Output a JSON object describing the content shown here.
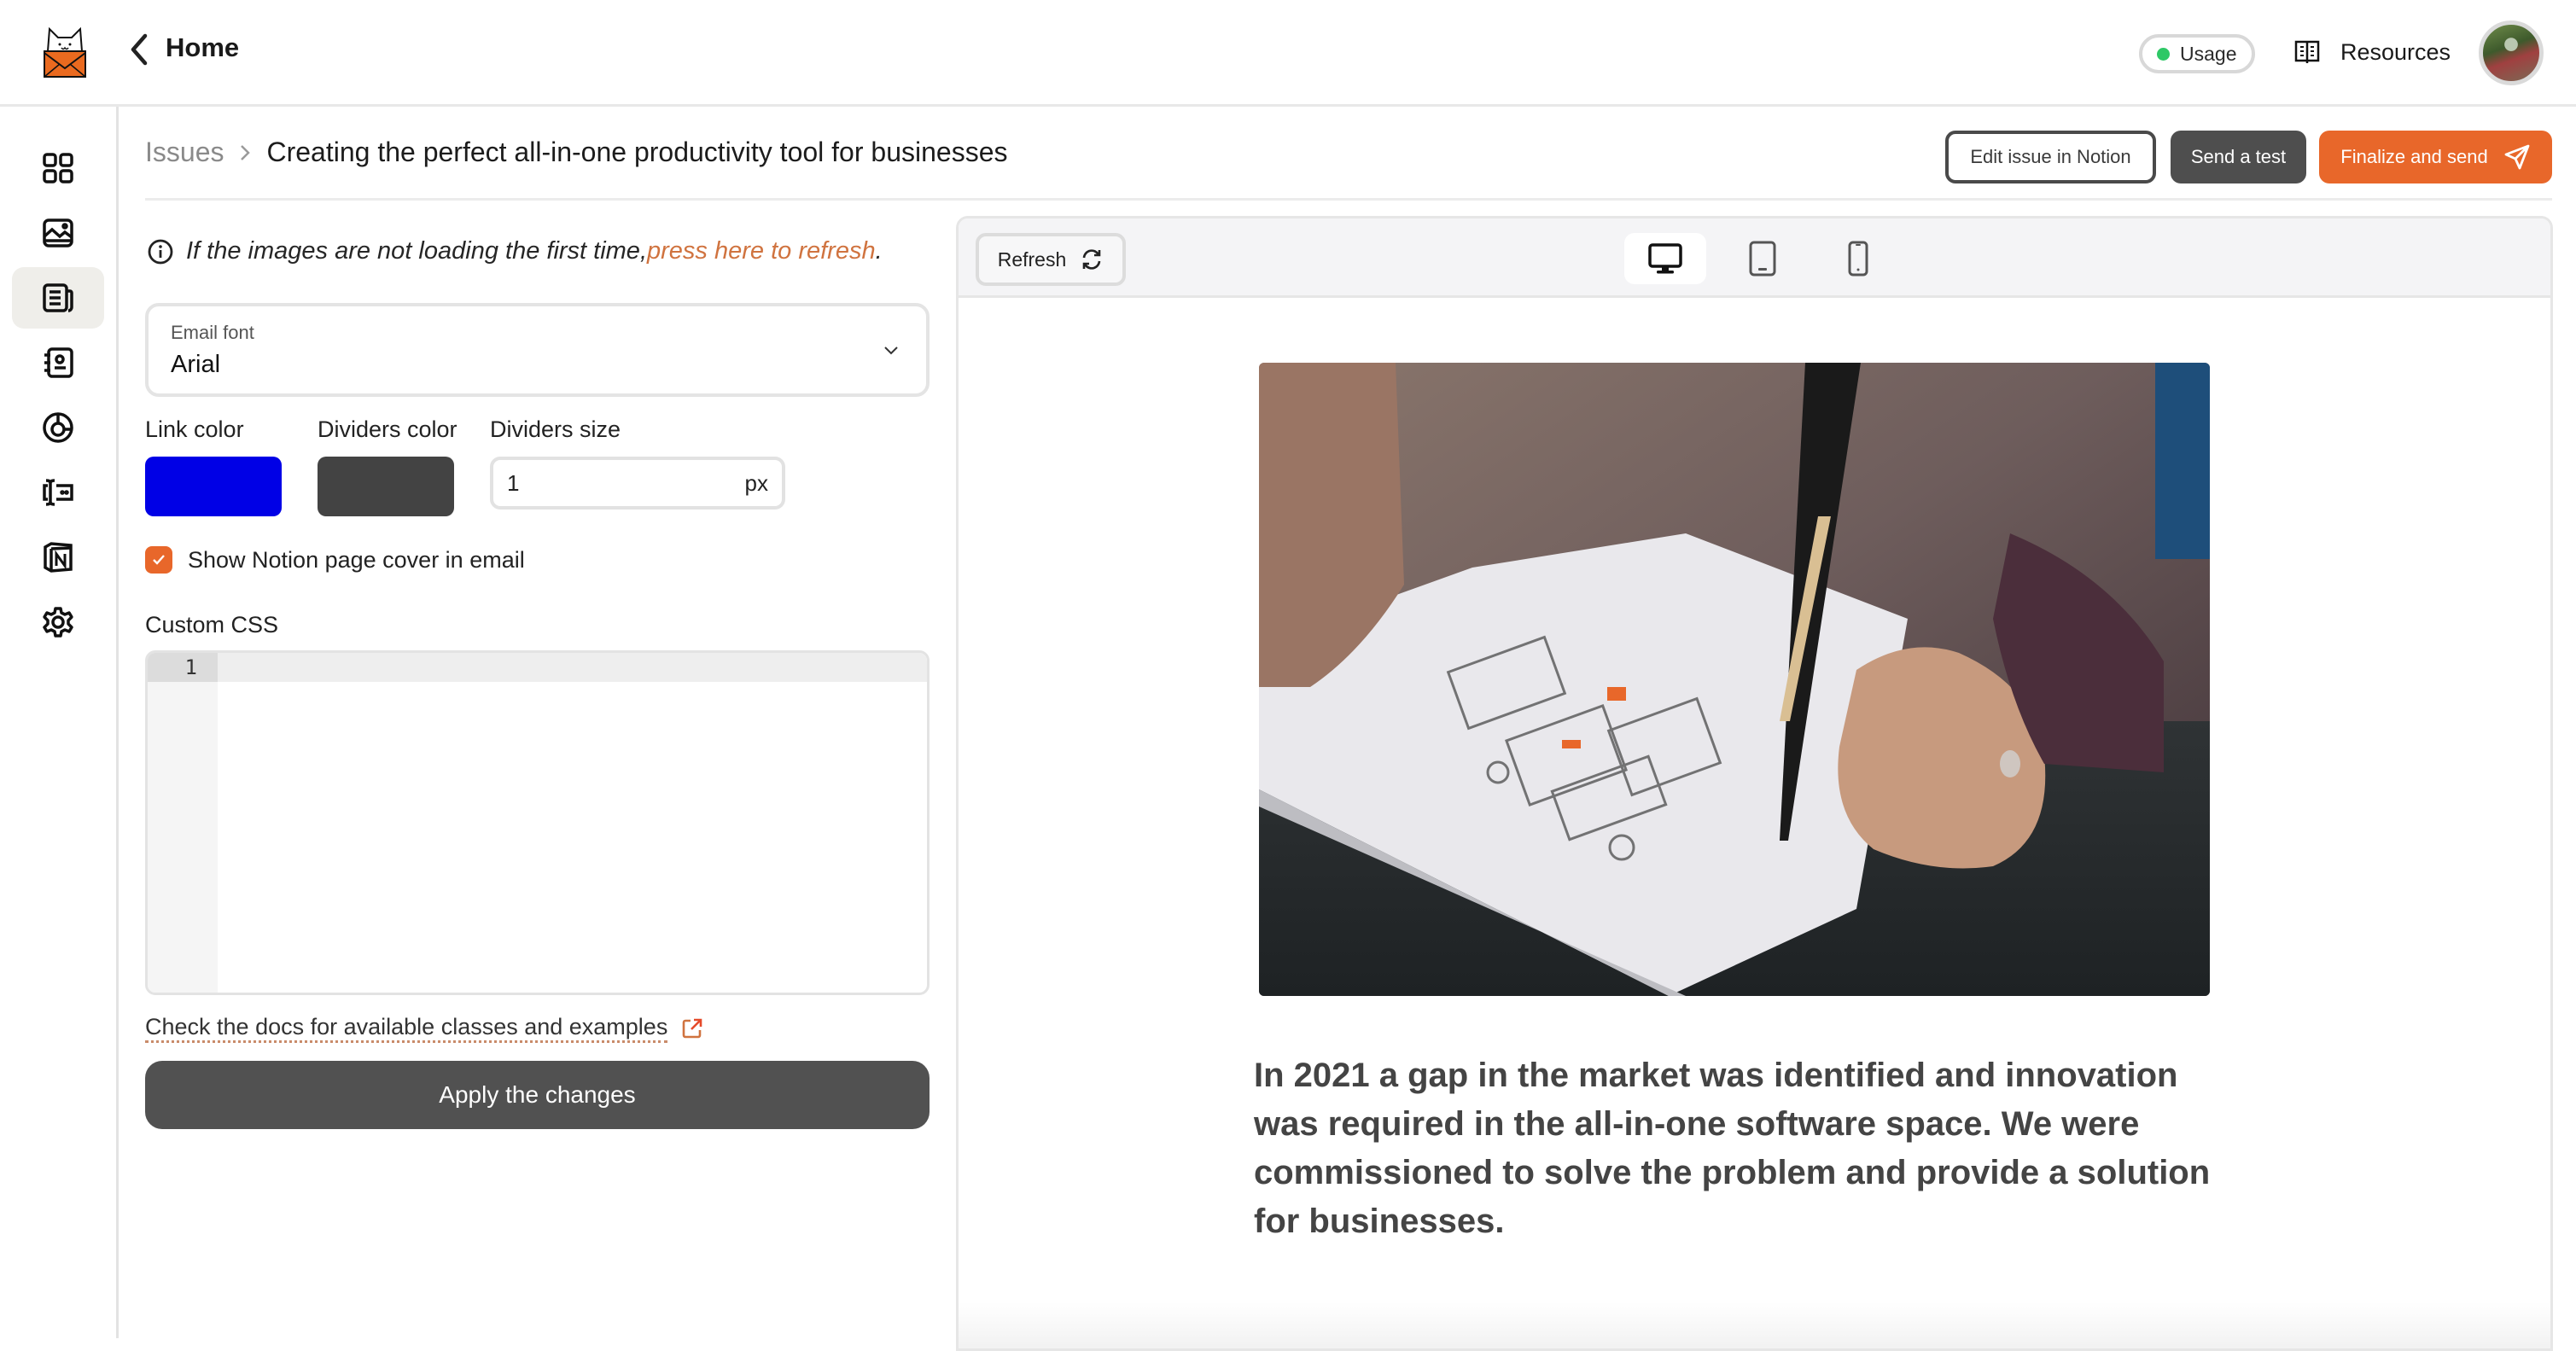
{
  "header": {
    "logo": "cat-mail-logo",
    "back_icon": "chevron-left-icon",
    "title": "Home",
    "usage_label": "Usage",
    "usage_status_color": "#2ec866",
    "resources_label": "Resources",
    "avatar": "user-avatar"
  },
  "sidebar": {
    "items": [
      {
        "name": "dashboard",
        "icon": "grid-icon",
        "active": false
      },
      {
        "name": "media",
        "icon": "image-icon",
        "active": false
      },
      {
        "name": "issues",
        "icon": "newspaper-icon",
        "active": true
      },
      {
        "name": "contacts",
        "icon": "address-book-icon",
        "active": false
      },
      {
        "name": "analytics",
        "icon": "pie-chart-icon",
        "active": false
      },
      {
        "name": "forms",
        "icon": "text-cursor-icon",
        "active": false
      },
      {
        "name": "notion",
        "icon": "notion-icon",
        "active": false
      },
      {
        "name": "settings",
        "icon": "gear-icon",
        "active": false
      }
    ]
  },
  "breadcrumb": {
    "parent": "Issues",
    "current": "Creating the perfect all-in-one productivity tool for businesses"
  },
  "actions": {
    "edit_label": "Edit issue in Notion",
    "test_label": "Send a test",
    "send_label": "Finalize and send",
    "accent_color": "#e8672a"
  },
  "settings": {
    "info_text": "If the images are not loading the first time, ",
    "info_link": "press here to refresh",
    "info_suffix": ".",
    "email_font_label": "Email font",
    "email_font_value": "Arial",
    "link_color_label": "Link color",
    "link_color": "#0000e6",
    "dividers_color_label": "Dividers color",
    "dividers_color": "#434343",
    "dividers_size_label": "Dividers size",
    "dividers_size_value": "1",
    "dividers_size_unit": "px",
    "show_cover_label": "Show Notion page cover in email",
    "show_cover_checked": true,
    "custom_css_label": "Custom CSS",
    "custom_css_line_number": "1",
    "custom_css_value": "",
    "docs_link": "Check the docs for available classes and examples",
    "apply_label": "Apply the changes"
  },
  "preview": {
    "refresh_label": "Refresh",
    "devices": [
      {
        "name": "desktop",
        "active": true
      },
      {
        "name": "tablet",
        "active": false
      },
      {
        "name": "mobile",
        "active": false
      }
    ],
    "cover_alt": "Hand sketching wireframes with a pen",
    "paragraph": "In 2021 a gap in the market was identified and innovation was required in the all-in-one software space. We were commissioned to solve the problem and provide a solution for businesses."
  }
}
